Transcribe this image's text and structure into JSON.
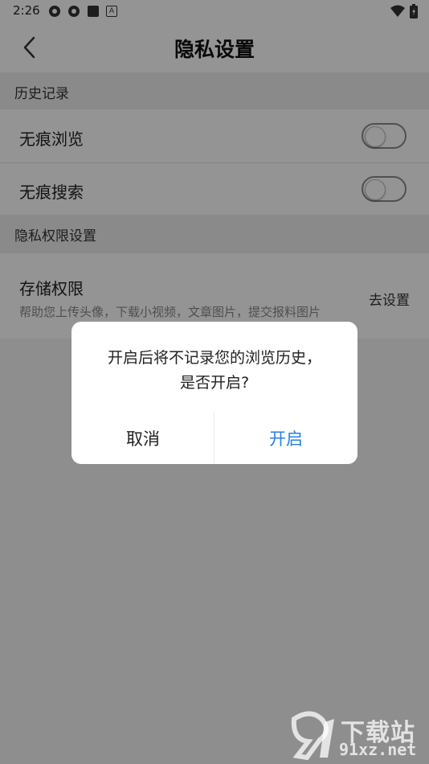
{
  "status": {
    "time": "2:26",
    "notif_badge": "A"
  },
  "header": {
    "title": "隐私设置"
  },
  "sections": {
    "history": {
      "title": "历史记录"
    },
    "permissions": {
      "title": "隐私权限设置"
    }
  },
  "rows": {
    "incognito_browse": {
      "label": "无痕浏览",
      "toggle_on": false
    },
    "incognito_search": {
      "label": "无痕搜索",
      "toggle_on": false
    },
    "storage": {
      "label": "存储权限",
      "description": "帮助您上传头像，下载小视频，文章图片，提交报料图片",
      "action": "去设置"
    }
  },
  "dialog": {
    "line1": "开启后将不记录您的浏览历史，",
    "line2": "是否开启?",
    "cancel": "取消",
    "confirm": "开启"
  },
  "watermark": {
    "brand": "下载站",
    "url": "91xz.net"
  },
  "colors": {
    "accent": "#2a7fe0",
    "overlay": "rgba(0,0,0,0.42)"
  }
}
